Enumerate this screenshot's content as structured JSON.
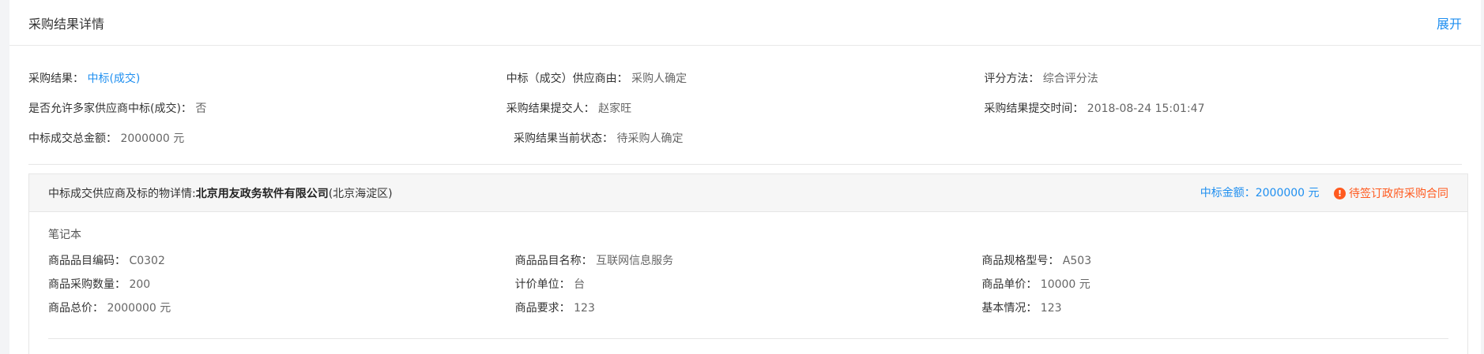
{
  "header": {
    "title": "采购结果详情",
    "expand_label": "展开"
  },
  "info": {
    "rows": [
      [
        {
          "label": "采购结果：",
          "value": "中标(成交)",
          "link": true
        },
        {
          "label": "中标（成交）供应商由：",
          "value": "采购人确定"
        },
        {
          "label": "评分方法：",
          "value": "综合评分法"
        }
      ],
      [
        {
          "label": "是否允许多家供应商中标(成交)：",
          "value": "否"
        },
        {
          "label": "采购结果提交人：",
          "value": "赵家旺"
        },
        {
          "label": "采购结果提交时间：",
          "value": "2018-08-24 15:01:47"
        }
      ],
      [
        {
          "label": "中标成交总金额：",
          "value": "2000000 元"
        },
        {
          "label": "采购结果当前状态：",
          "value": "待采购人确定"
        },
        null
      ]
    ]
  },
  "supplier": {
    "prefix": "中标成交供应商及标的物详情:",
    "name": "北京用友政务软件有限公司",
    "region": "(北京海淀区)",
    "amount": "中标金额：2000000 元",
    "status": "待签订政府采购合同",
    "item_name": "笔记本",
    "rows": [
      [
        {
          "label": "商品品目编码：",
          "value": "C0302"
        },
        {
          "label": "商品品目名称：",
          "value": "互联网信息服务"
        },
        {
          "label": "商品规格型号：",
          "value": "A503"
        }
      ],
      [
        {
          "label": "商品采购数量：",
          "value": "200"
        },
        {
          "label": "计价单位：",
          "value": "台"
        },
        {
          "label": "商品单价：",
          "value": "10000 元"
        }
      ],
      [
        {
          "label": "商品总价：",
          "value": "2000000 元"
        },
        {
          "label": "商品要求：",
          "value": "123"
        },
        {
          "label": "基本情况：",
          "value": "123"
        }
      ]
    ]
  }
}
